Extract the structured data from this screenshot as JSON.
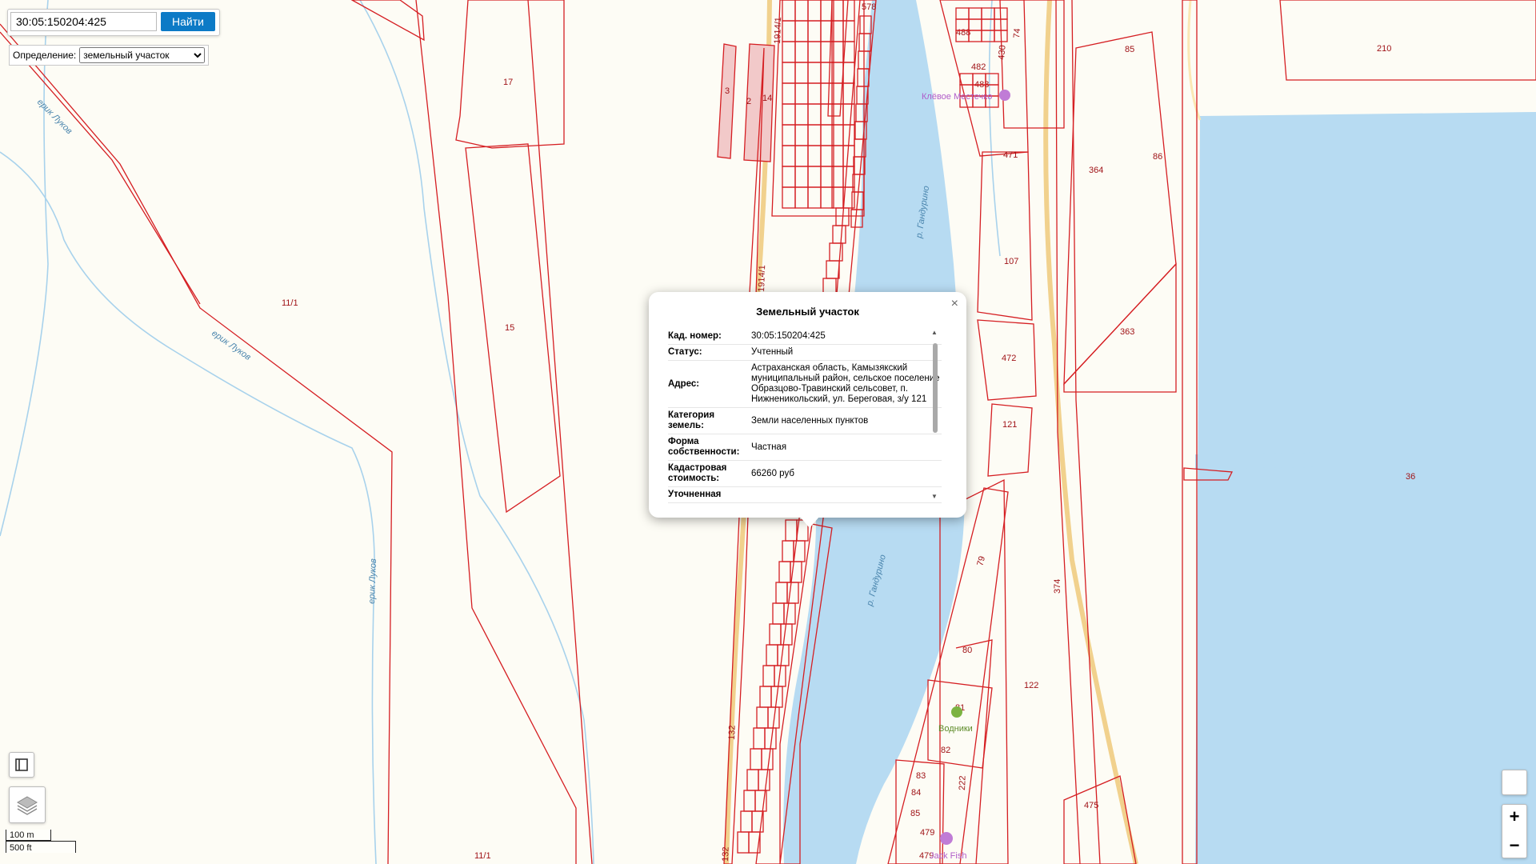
{
  "search": {
    "value": "30:05:150204:425",
    "button_label": "Найти"
  },
  "definition": {
    "label": "Определение:",
    "selected": "земельный участок"
  },
  "popup": {
    "title": "Земельный участок",
    "close_glyph": "×",
    "rows": [
      {
        "key": "Кад. номер:",
        "value": "30:05:150204:425"
      },
      {
        "key": "Статус:",
        "value": "Учтенный"
      },
      {
        "key": "Адрес:",
        "value": "Астраханская область, Камызякский муниципальный район, сельское поселение Образцово-Травинский сельсовет, п. Нижненикольский, ул. Береговая, з/у 121"
      },
      {
        "key": "Категория земель:",
        "value": "Земли населенных пунктов"
      },
      {
        "key": "Форма собственности:",
        "value": "Частная"
      },
      {
        "key": "Кадастровая стоимость:",
        "value": "66260 руб"
      },
      {
        "key": "Уточненная",
        "value": ""
      }
    ]
  },
  "map": {
    "parcel_labels": [
      "17",
      "11/1",
      "15",
      "11/1",
      "1914/1",
      "1914/1",
      "578",
      "3",
      "2",
      "14",
      "488",
      "482",
      "483",
      "430",
      "74",
      "471",
      "107",
      "472",
      "121",
      "85",
      "210",
      "364",
      "86",
      "363",
      "36",
      "79",
      "80",
      "81",
      "82",
      "83",
      "84",
      "85",
      "222",
      "479",
      "479",
      "475",
      "122",
      "374",
      "132",
      "132"
    ],
    "water_labels": [
      "ерик Луков",
      "ерик Луков",
      "ерик Луков",
      "р. Гандурино",
      "р. Гандурино"
    ],
    "poi_labels": [
      "Клёвое Местечко",
      "Водники",
      "Jack Fish"
    ]
  },
  "scale": {
    "metric": "100 m",
    "imperial": "500 ft"
  },
  "controls": {
    "zoom_in": "+",
    "zoom_out": "−"
  },
  "colors": {
    "parcel": "#d51e22",
    "water": "#b7dbf2",
    "button": "#0c7ac6"
  }
}
